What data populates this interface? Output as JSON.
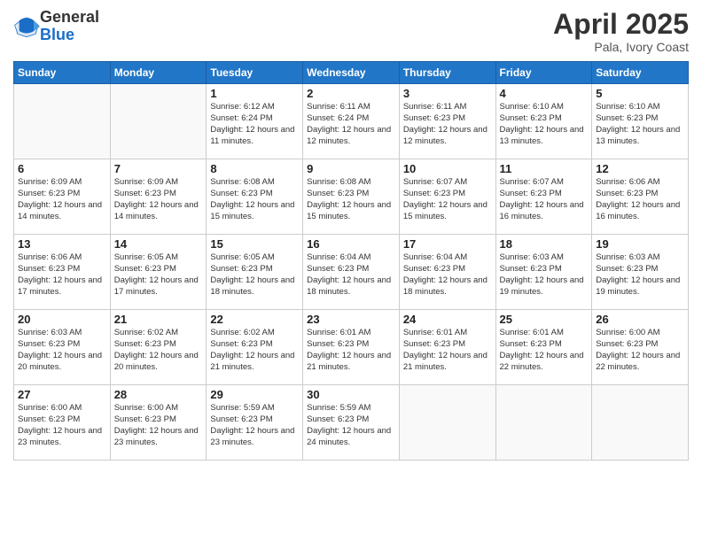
{
  "header": {
    "logo_general": "General",
    "logo_blue": "Blue",
    "title": "April 2025",
    "location": "Pala, Ivory Coast"
  },
  "weekdays": [
    "Sunday",
    "Monday",
    "Tuesday",
    "Wednesday",
    "Thursday",
    "Friday",
    "Saturday"
  ],
  "weeks": [
    [
      {
        "day": "",
        "info": ""
      },
      {
        "day": "",
        "info": ""
      },
      {
        "day": "1",
        "info": "Sunrise: 6:12 AM\nSunset: 6:24 PM\nDaylight: 12 hours and 11 minutes."
      },
      {
        "day": "2",
        "info": "Sunrise: 6:11 AM\nSunset: 6:24 PM\nDaylight: 12 hours and 12 minutes."
      },
      {
        "day": "3",
        "info": "Sunrise: 6:11 AM\nSunset: 6:23 PM\nDaylight: 12 hours and 12 minutes."
      },
      {
        "day": "4",
        "info": "Sunrise: 6:10 AM\nSunset: 6:23 PM\nDaylight: 12 hours and 13 minutes."
      },
      {
        "day": "5",
        "info": "Sunrise: 6:10 AM\nSunset: 6:23 PM\nDaylight: 12 hours and 13 minutes."
      }
    ],
    [
      {
        "day": "6",
        "info": "Sunrise: 6:09 AM\nSunset: 6:23 PM\nDaylight: 12 hours and 14 minutes."
      },
      {
        "day": "7",
        "info": "Sunrise: 6:09 AM\nSunset: 6:23 PM\nDaylight: 12 hours and 14 minutes."
      },
      {
        "day": "8",
        "info": "Sunrise: 6:08 AM\nSunset: 6:23 PM\nDaylight: 12 hours and 15 minutes."
      },
      {
        "day": "9",
        "info": "Sunrise: 6:08 AM\nSunset: 6:23 PM\nDaylight: 12 hours and 15 minutes."
      },
      {
        "day": "10",
        "info": "Sunrise: 6:07 AM\nSunset: 6:23 PM\nDaylight: 12 hours and 15 minutes."
      },
      {
        "day": "11",
        "info": "Sunrise: 6:07 AM\nSunset: 6:23 PM\nDaylight: 12 hours and 16 minutes."
      },
      {
        "day": "12",
        "info": "Sunrise: 6:06 AM\nSunset: 6:23 PM\nDaylight: 12 hours and 16 minutes."
      }
    ],
    [
      {
        "day": "13",
        "info": "Sunrise: 6:06 AM\nSunset: 6:23 PM\nDaylight: 12 hours and 17 minutes."
      },
      {
        "day": "14",
        "info": "Sunrise: 6:05 AM\nSunset: 6:23 PM\nDaylight: 12 hours and 17 minutes."
      },
      {
        "day": "15",
        "info": "Sunrise: 6:05 AM\nSunset: 6:23 PM\nDaylight: 12 hours and 18 minutes."
      },
      {
        "day": "16",
        "info": "Sunrise: 6:04 AM\nSunset: 6:23 PM\nDaylight: 12 hours and 18 minutes."
      },
      {
        "day": "17",
        "info": "Sunrise: 6:04 AM\nSunset: 6:23 PM\nDaylight: 12 hours and 18 minutes."
      },
      {
        "day": "18",
        "info": "Sunrise: 6:03 AM\nSunset: 6:23 PM\nDaylight: 12 hours and 19 minutes."
      },
      {
        "day": "19",
        "info": "Sunrise: 6:03 AM\nSunset: 6:23 PM\nDaylight: 12 hours and 19 minutes."
      }
    ],
    [
      {
        "day": "20",
        "info": "Sunrise: 6:03 AM\nSunset: 6:23 PM\nDaylight: 12 hours and 20 minutes."
      },
      {
        "day": "21",
        "info": "Sunrise: 6:02 AM\nSunset: 6:23 PM\nDaylight: 12 hours and 20 minutes."
      },
      {
        "day": "22",
        "info": "Sunrise: 6:02 AM\nSunset: 6:23 PM\nDaylight: 12 hours and 21 minutes."
      },
      {
        "day": "23",
        "info": "Sunrise: 6:01 AM\nSunset: 6:23 PM\nDaylight: 12 hours and 21 minutes."
      },
      {
        "day": "24",
        "info": "Sunrise: 6:01 AM\nSunset: 6:23 PM\nDaylight: 12 hours and 21 minutes."
      },
      {
        "day": "25",
        "info": "Sunrise: 6:01 AM\nSunset: 6:23 PM\nDaylight: 12 hours and 22 minutes."
      },
      {
        "day": "26",
        "info": "Sunrise: 6:00 AM\nSunset: 6:23 PM\nDaylight: 12 hours and 22 minutes."
      }
    ],
    [
      {
        "day": "27",
        "info": "Sunrise: 6:00 AM\nSunset: 6:23 PM\nDaylight: 12 hours and 23 minutes."
      },
      {
        "day": "28",
        "info": "Sunrise: 6:00 AM\nSunset: 6:23 PM\nDaylight: 12 hours and 23 minutes."
      },
      {
        "day": "29",
        "info": "Sunrise: 5:59 AM\nSunset: 6:23 PM\nDaylight: 12 hours and 23 minutes."
      },
      {
        "day": "30",
        "info": "Sunrise: 5:59 AM\nSunset: 6:23 PM\nDaylight: 12 hours and 24 minutes."
      },
      {
        "day": "",
        "info": ""
      },
      {
        "day": "",
        "info": ""
      },
      {
        "day": "",
        "info": ""
      }
    ]
  ]
}
